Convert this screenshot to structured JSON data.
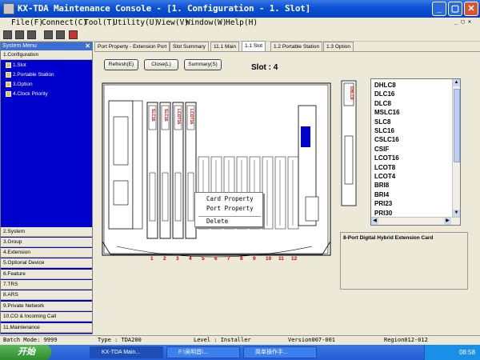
{
  "window": {
    "title": "KX-TDA Maintenance Console - [1. Configuration - 1. Slot]",
    "min_label": "_",
    "max_label": "▢",
    "close_label": "✕"
  },
  "menu": [
    "File(F)",
    "Connect(C)",
    "Tool(T)",
    "Utility(U)",
    "View(V)",
    "Window(W)",
    "Help(H)"
  ],
  "mdi_controls": "_ ▢ ✕",
  "system_menu": {
    "header": "System Menu",
    "close": "✕",
    "open_category": "1.Configuration",
    "tree": [
      "1.Slot",
      "2.Portable Station",
      "3.Option",
      "4.Clock Priority"
    ],
    "categories": [
      "2.System",
      "3.Group",
      "4.Extension",
      "5.Optional Device",
      "6.Feature",
      "7.TRS",
      "8.ARS",
      "9.Private Network",
      "10.CO & Incoming Call",
      "11.Maintenance"
    ]
  },
  "tabs": [
    "Port Property - Extension Port",
    "Slot Summary",
    "11.1 Main",
    "1.1 Slot",
    "1.2 Portable Station",
    "1.3 Option"
  ],
  "active_tab": "1.1 Slot",
  "buttons": {
    "refresh": "Refresh(E)",
    "close": "Close(L)",
    "summary": "Summary(S)"
  },
  "slot_label": "Slot : 4",
  "rack": {
    "card_labels": [
      "SLC16",
      "SLC16",
      "LCOT16",
      "LCOT16"
    ],
    "side_card_label": "DHLC8",
    "slot_numbers": [
      "1",
      "2",
      "3",
      "4",
      "5",
      "6",
      "7",
      "8",
      "9",
      "10",
      "11",
      "12"
    ]
  },
  "card_list": [
    "DHLC8",
    "DLC16",
    "DLC8",
    "MSLC16",
    "SLC8",
    "SLC16",
    "CSLC16",
    "CSIF",
    "LCOT16",
    "LCOT8",
    "LCOT4",
    "BRI8",
    "BRI4",
    "PRI23",
    "PRI30"
  ],
  "card_description": "8-Port Digital Hybrid Extension Card",
  "context_menu": [
    "Card Property",
    "Port Property",
    "Delete"
  ],
  "status": {
    "batch_mode": "Batch Mode: 9999",
    "type": "Type : TDA200",
    "level": "Level : Installer",
    "version": "Version007-001",
    "region": "Region012-012"
  },
  "taskbar": {
    "start": "开始",
    "tasks": [
      "KX-TDA Main...",
      "F:\\吴明昌\\...",
      "简单操作手..."
    ],
    "clock": "08:58"
  },
  "colors": {
    "titlebar": "#0a4fd6",
    "side_panel": "#0000cc",
    "card_label_red": "#cc0000",
    "selected_slot_blue": "#0000cc"
  }
}
